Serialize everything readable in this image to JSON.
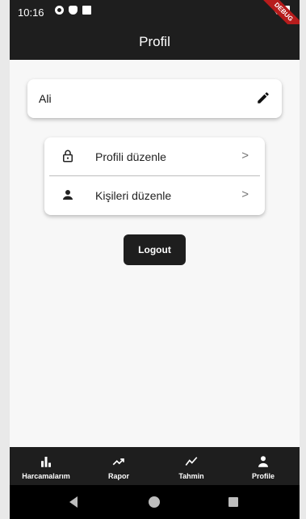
{
  "status_bar": {
    "time": "10:16",
    "debug_banner": "DEBUG"
  },
  "app_bar": {
    "title": "Profil"
  },
  "profile": {
    "name": "Ali",
    "edit_icon": "pencil-icon"
  },
  "menu": {
    "items": [
      {
        "label": "Profili düzenle",
        "icon": "lock-icon"
      },
      {
        "label": "Kişileri düzenle",
        "icon": "person-icon"
      }
    ],
    "chevron": ">"
  },
  "logout": {
    "label": "Logout"
  },
  "bottom_nav": {
    "items": [
      {
        "label": "Harcamalarım",
        "icon": "bar-chart-icon"
      },
      {
        "label": "Rapor",
        "icon": "trending-up-icon"
      },
      {
        "label": "Tahmin",
        "icon": "show-chart-icon"
      },
      {
        "label": "Profile",
        "icon": "person-icon"
      }
    ]
  },
  "colors": {
    "dark": "#1e1e1e",
    "background": "#f7f7f7",
    "card": "#ffffff",
    "debug": "#b71c1c"
  }
}
